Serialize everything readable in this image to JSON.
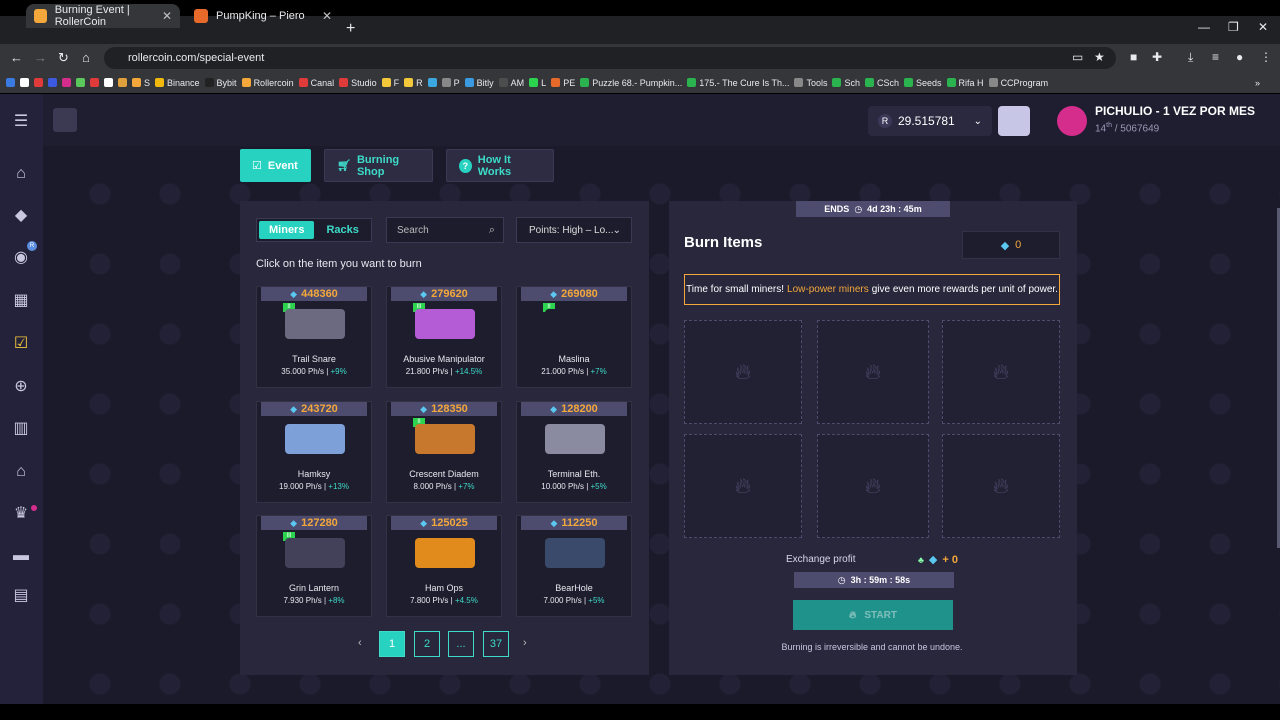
{
  "browser": {
    "tabs": [
      {
        "title": "Burning Event | RollerCoin",
        "close": "✕"
      },
      {
        "title": "PumpKing – Piero",
        "close": "✕"
      }
    ],
    "new_tab": "+",
    "window_controls": [
      "—",
      "❐",
      "✕"
    ],
    "url": "rollercoin.com/special-event",
    "nav": {
      "back": "←",
      "forward": "→",
      "reload": "↻",
      "home": "⌂"
    },
    "bookmarks": [
      "",
      "",
      "",
      "",
      "",
      "",
      "",
      "",
      "",
      "S",
      "Binance",
      "Bybit",
      "Rollercoin",
      "Canal",
      "Studio",
      "F",
      "R",
      "",
      "P",
      "Bitly",
      "AM",
      "L",
      "PE",
      "Puzzle 68.- Pumpkin...",
      "175.- The Cure Is Th...",
      "Tools",
      "Sch",
      "CSch",
      "Seeds",
      "Rifa H",
      "CCProgram"
    ],
    "bookmarks_more": "»"
  },
  "header": {
    "balance": "29.515781",
    "balance_symbol": "R",
    "username": "PICHULIO - 1 VEZ POR MES",
    "rank": "14",
    "rank_suffix": "th",
    "rank_total": "/ 5067649"
  },
  "sidebar": {
    "items": [
      "home-icon",
      "gamepad-icon",
      "roller-icon",
      "calendar-icon",
      "event-icon",
      "cart-icon",
      "building-icon",
      "house-icon",
      "trophy-icon",
      "tool-icon",
      "news-icon"
    ],
    "badge": "R"
  },
  "top_tabs": {
    "event": "Event",
    "burning_shop": "Burning Shop",
    "how_it_works": "How It Works"
  },
  "left": {
    "segment": {
      "miners": "Miners",
      "racks": "Racks"
    },
    "search_placeholder": "Search",
    "sort": "Points: High – Lo...",
    "hint": "Click on the item you want to burn",
    "cards": [
      {
        "points": "448360",
        "name": "Trail Snare",
        "power": "35.000 Ph/s |",
        "bonus": "+9%",
        "level": "II",
        "color": "#6b6a80"
      },
      {
        "points": "279620",
        "name": "Abusive Manipulator",
        "power": "21.800 Ph/s |",
        "bonus": "+14.5%",
        "level": "III",
        "color": "#b45bd6"
      },
      {
        "points": "269080",
        "name": "Maslina",
        "power": "21.000 Ph/s |",
        "bonus": "+7%",
        "level": "II",
        "color": "#1e1d2d"
      },
      {
        "points": "243720",
        "name": "Hamksy",
        "power": "19.000 Ph/s |",
        "bonus": "+13%",
        "level": "",
        "color": "#7ea0d8"
      },
      {
        "points": "128350",
        "name": "Crescent Diadem",
        "power": "8.000 Ph/s |",
        "bonus": "+7%",
        "level": "II",
        "color": "#c8782c"
      },
      {
        "points": "128200",
        "name": "Terminal Eth.",
        "power": "10.000 Ph/s |",
        "bonus": "+5%",
        "level": "",
        "color": "#8a8aa0"
      },
      {
        "points": "127280",
        "name": "Grin Lantern",
        "power": "7.930 Ph/s |",
        "bonus": "+8%",
        "level": "III",
        "color": "#43415a"
      },
      {
        "points": "125025",
        "name": "Ham Ops",
        "power": "7.800 Ph/s |",
        "bonus": "+4.5%",
        "level": "",
        "color": "#e08b1c"
      },
      {
        "points": "112250",
        "name": "BearHole",
        "power": "7.000 Ph/s |",
        "bonus": "+5%",
        "level": "",
        "color": "#3a4a6a"
      }
    ],
    "pagination": {
      "pages": [
        "1",
        "2",
        "...",
        "37"
      ],
      "current": "1",
      "prev": "‹",
      "next": "›"
    }
  },
  "right": {
    "ends_label": "ENDS",
    "ends_time": "4d 23h : 45m",
    "title": "Burn Items",
    "score": "0",
    "notice_pre": "Time for small miners!",
    "notice_highlight": "Low-power miners",
    "notice_post": "give even more rewards per unit of power.",
    "exchange_label": "Exchange profit",
    "exchange_value": "+ 0",
    "timer": "3h : 59m : 58s",
    "start": "START",
    "warning": "Burning is irreversible and cannot be undone."
  },
  "colors": {
    "accent": "#27d3c0",
    "orange": "#f4a83b",
    "panel": "#28273c",
    "bg": "#1b1a2b"
  }
}
